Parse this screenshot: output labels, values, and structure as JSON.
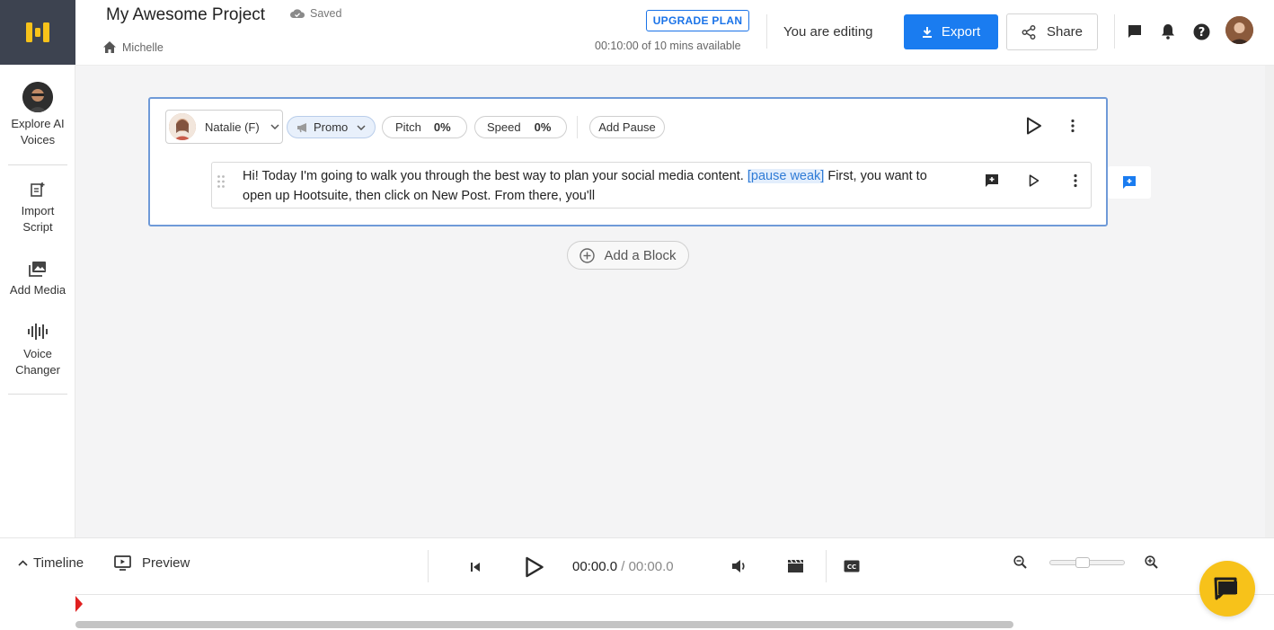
{
  "app": {
    "brand_color": "#f7c21a",
    "accent": "#1a7cf0"
  },
  "header": {
    "project_title": "My Awesome Project",
    "saved_label": "Saved",
    "breadcrumb_user": "Michelle",
    "upgrade_label": "UPGRADE PLAN",
    "time_available": "00:10:00 of 10 mins available",
    "editing_label": "You are editing",
    "export_label": "Export",
    "share_label": "Share"
  },
  "sidebar": {
    "items": [
      {
        "label": "Explore AI Voices",
        "icon": "voice-avatar"
      },
      {
        "label": "Import Script",
        "icon": "import-icon"
      },
      {
        "label": "Add Media",
        "icon": "media-icon"
      },
      {
        "label": "Voice Changer",
        "icon": "waveform-icon"
      }
    ]
  },
  "block": {
    "voice_name": "Natalie (F)",
    "style_label": "Promo",
    "pitch_label": "Pitch",
    "pitch_value": "0%",
    "speed_label": "Speed",
    "speed_value": "0%",
    "add_pause_label": "Add Pause",
    "text_before": "Hi! Today I'm going to walk you through the best way to plan your social media content. ",
    "pause_tag": "[pause weak]",
    "text_after": " First, you want to open up Hootsuite, then click on New Post. From there, you'll"
  },
  "add_block_label": "Add a Block",
  "bottom": {
    "timeline_label": "Timeline",
    "preview_label": "Preview",
    "current_time": "00:00.0",
    "separator": " / ",
    "total_time": "00:00.0"
  }
}
